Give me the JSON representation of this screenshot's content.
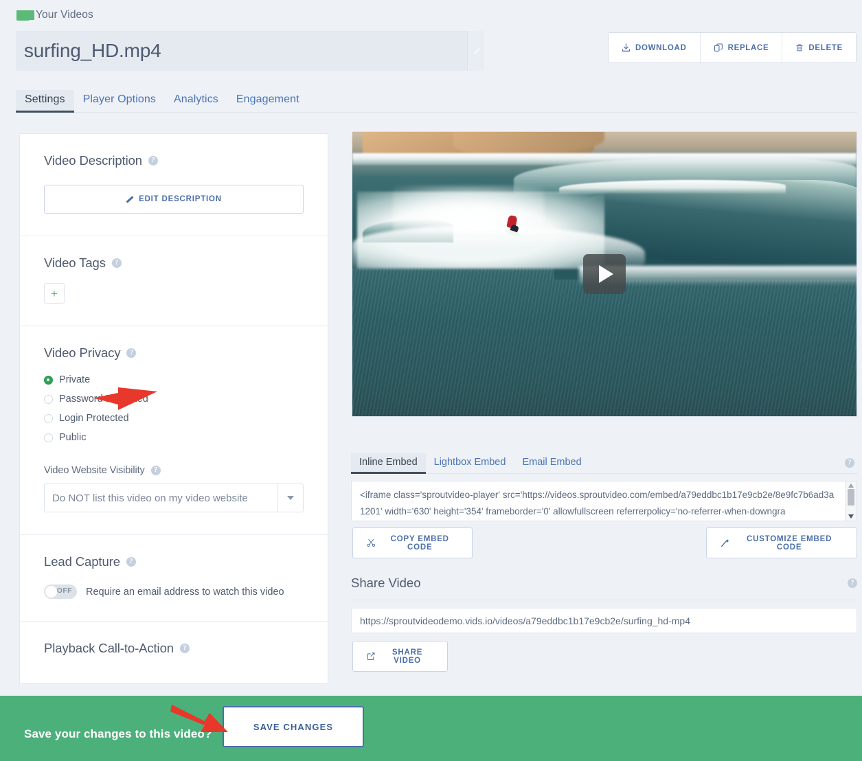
{
  "breadcrumb": {
    "label": "Your Videos",
    "icon": "folder-icon"
  },
  "header": {
    "video_title": "surfing_HD.mp4",
    "edit_title_icon": "pencil-icon",
    "actions": [
      {
        "label": "DOWNLOAD",
        "icon": "download-icon"
      },
      {
        "label": "REPLACE",
        "icon": "replace-icon"
      },
      {
        "label": "DELETE",
        "icon": "trash-icon"
      }
    ]
  },
  "tabs": [
    {
      "label": "Settings",
      "active": true
    },
    {
      "label": "Player Options",
      "active": false
    },
    {
      "label": "Analytics",
      "active": false
    },
    {
      "label": "Engagement",
      "active": false
    }
  ],
  "settings": {
    "description": {
      "title": "Video Description",
      "help": "?",
      "edit_button": "EDIT DESCRIPTION"
    },
    "tags": {
      "title": "Video Tags",
      "help": "?",
      "add_button": "+"
    },
    "privacy": {
      "title": "Video Privacy",
      "help": "?",
      "options": [
        {
          "label": "Private",
          "selected": true
        },
        {
          "label": "Password Protected",
          "selected": false
        },
        {
          "label": "Login Protected",
          "selected": false
        },
        {
          "label": "Public",
          "selected": false
        }
      ],
      "visibility_label": "Video Website Visibility",
      "visibility_help": "?",
      "visibility_value": "Do NOT list this video on my video website"
    },
    "lead_capture": {
      "title": "Lead Capture",
      "help": "?",
      "toggle_state": "OFF",
      "toggle_description": "Require an email address to watch this video"
    },
    "playback_cta": {
      "title": "Playback Call-to-Action",
      "help": "?"
    }
  },
  "player": {
    "play_button": "play-icon",
    "thumbnail_alt": "surfer riding a wave"
  },
  "embed": {
    "tabs": [
      {
        "label": "Inline Embed",
        "active": true
      },
      {
        "label": "Lightbox Embed",
        "active": false
      },
      {
        "label": "Email Embed",
        "active": false
      }
    ],
    "help": "?",
    "code": "<iframe class='sproutvideo-player' src='https://videos.sproutvideo.com/embed/a79eddbc1b17e9cb2e/8e9fc7b6ad3a1201' width='630' height='354' frameborder='0' allowfullscreen referrerpolicy='no-referrer-when-downgra",
    "copy_button": "COPY EMBED CODE",
    "customize_button": "CUSTOMIZE EMBED CODE"
  },
  "share": {
    "title": "Share Video",
    "help": "?",
    "url": "https://sproutvideodemo.vids.io/videos/a79eddbc1b17e9cb2e/surfing_hd-mp4",
    "share_button": "SHARE VIDEO"
  },
  "save_bar": {
    "message": "Save your changes to this video?",
    "button": "SAVE CHANGES",
    "background": "#4cb07a"
  },
  "annotations": {
    "arrow_color": "#e8372b",
    "arrow_privacy_target": "Private",
    "arrow_save_target": "SAVE CHANGES"
  },
  "colors": {
    "page_background": "#eef1f6",
    "accent_blue": "#4a6ea9",
    "accent_green": "#4cb07a",
    "radio_selected": "#2aa057",
    "text_dark": "#4f5b6e"
  }
}
